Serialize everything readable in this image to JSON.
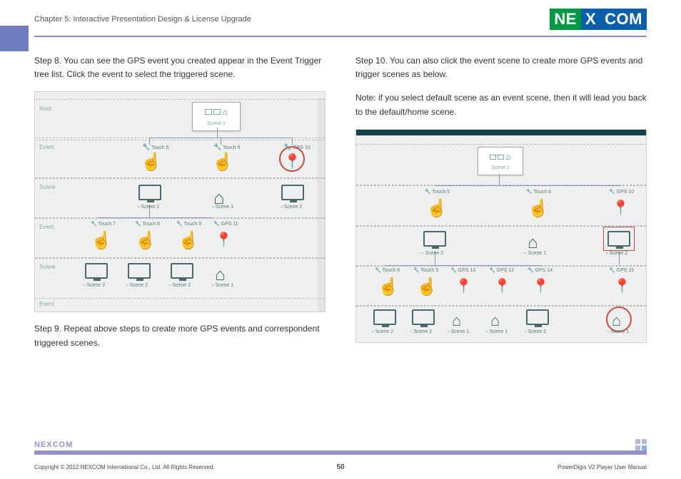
{
  "header": {
    "chapter": "Chapter 5: Interactive Presentation Design & License Upgrade",
    "logo_left": "NE",
    "logo_mid": "X",
    "logo_right": "COM"
  },
  "leftCol": {
    "step8": "Step 8. You can see the GPS event you created appear in the Event Trigger tree list. Click the event to select the triggered scene.",
    "step9": "Step 9. Repeat above steps to create more GPS events and correspondent triggered scenes."
  },
  "rightCol": {
    "step10": "Step 10. You can also click the event scene to create more GPS events and trigger scenes as below.",
    "note": "Note: if you select default scene as an event scene, then it will lead you back to the default/home scene."
  },
  "shot1": {
    "rows": {
      "r1": "Root",
      "r2": "Event",
      "r3": "Scene",
      "r4": "Event",
      "r5": "Scene",
      "r6": "Event"
    },
    "sceneRoot": "Scene 1",
    "nodes": {
      "touch5": "Touch 5",
      "touch6": "Touch 6",
      "gps10": "GPS 10",
      "scene2a": "Scene 2",
      "scene1a": "Scene 1",
      "scene2b": "Scene 2",
      "touch7": "Touch 7",
      "touch8": "Touch 8",
      "touch9": "Touch 9",
      "gps11": "GPS 11",
      "scene2c": "Scene 2",
      "scene2d": "Scene 2",
      "scene2e": "Scene 2",
      "scene1b": "Scene 1"
    }
  },
  "shot2": {
    "sceneRoot": "Scene 1",
    "nodes": {
      "touch5": "Touch 5",
      "touch6": "Touch 6",
      "gps10": "GPS 10",
      "scene2a": "Scene 2",
      "scene1a": "Scene 1",
      "scene2b": "Scene 2",
      "touch8": "Touch 8",
      "touch9": "Touch 9",
      "gps13": "GPS 13",
      "gps12": "GPS 12",
      "gps14": "GPS 14",
      "gps15": "GPS 15",
      "sceneBL": {
        "s1": "Scene 2",
        "s2": "Scene 2",
        "s3": "Scene 1",
        "s4": "Scene 1",
        "s5": "Scene 2",
        "s6": "Scene 1"
      }
    }
  },
  "footer": {
    "logo": "NEXCOM",
    "copyright": "Copyright © 2012 NEXCOM International Co., Ltd. All Rights Reserved.",
    "page": "50",
    "manual": "PowerDigis V2 Player User Manual"
  }
}
